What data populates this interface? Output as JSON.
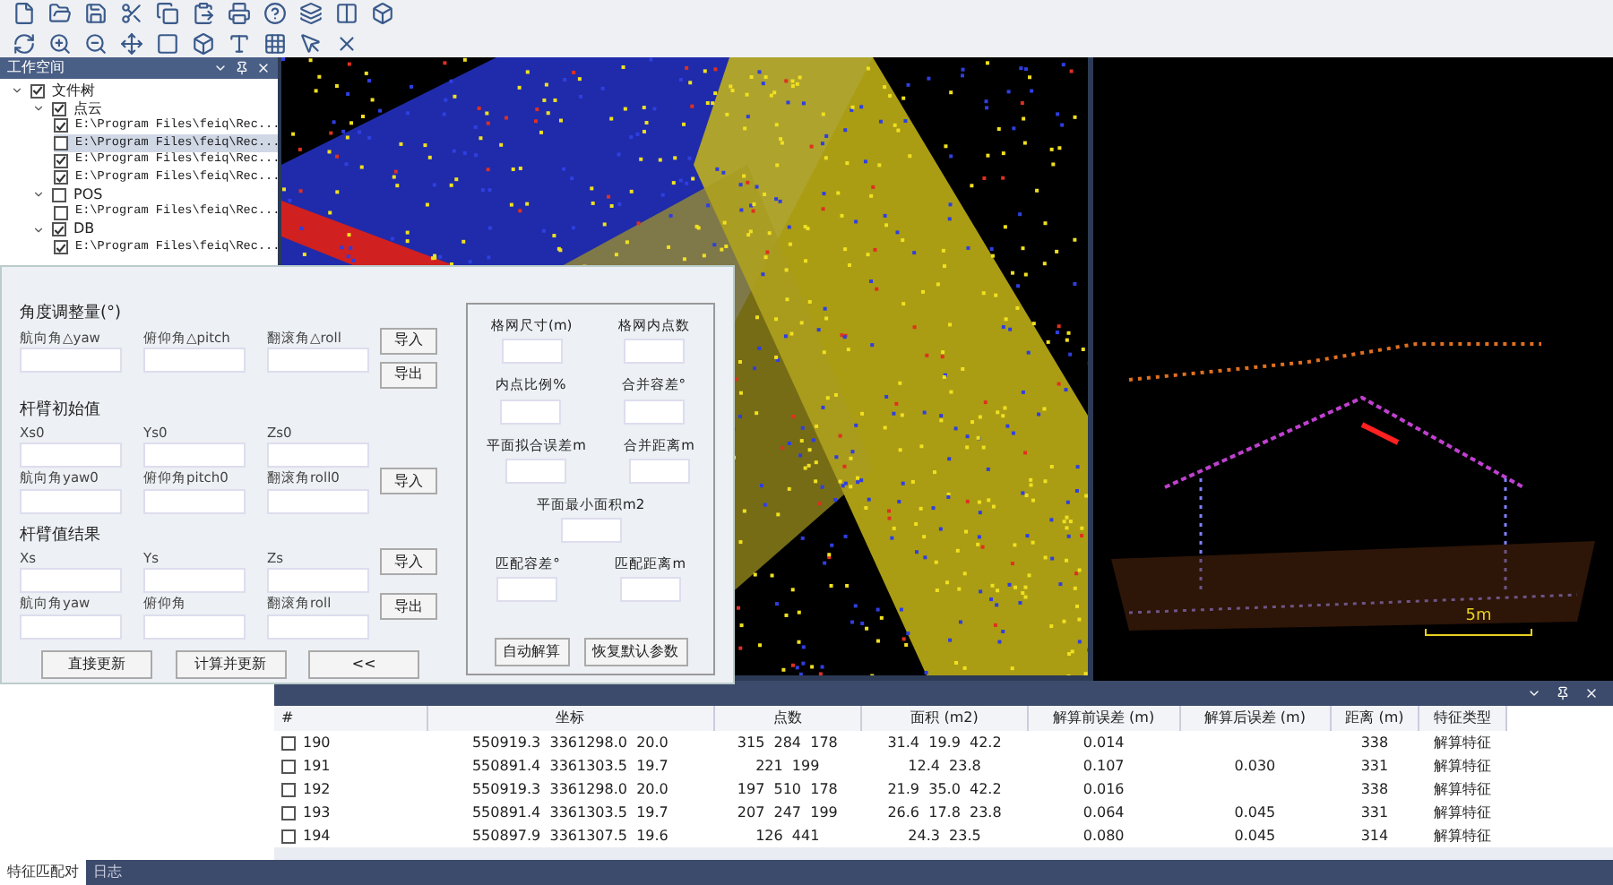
{
  "workspace": {
    "title": "工作空间",
    "tree": [
      {
        "label": "文件树",
        "checked": true,
        "expanded": true,
        "children": [
          {
            "label": "点云",
            "checked": true,
            "expanded": true,
            "children": [
              {
                "label": "E:\\Program Files\\feiq\\Rec...",
                "checked": true,
                "selected": false
              },
              {
                "label": "E:\\Program Files\\feiq\\Rec...",
                "checked": false,
                "selected": true
              },
              {
                "label": "E:\\Program Files\\feiq\\Rec...",
                "checked": true,
                "selected": false
              },
              {
                "label": "E:\\Program Files\\feiq\\Rec...",
                "checked": true,
                "selected": false
              }
            ]
          },
          {
            "label": "POS",
            "checked": false,
            "expanded": true,
            "children": [
              {
                "label": "E:\\Program Files\\feiq\\Rec...",
                "checked": false,
                "selected": false
              }
            ]
          },
          {
            "label": "DB",
            "checked": true,
            "expanded": true,
            "children": [
              {
                "label": "E:\\Program Files\\feiq\\Rec...",
                "checked": true,
                "selected": false
              }
            ]
          }
        ]
      }
    ]
  },
  "dialog": {
    "sections": [
      {
        "title": "角度调整量(°)",
        "rows": [
          {
            "labels": [
              "航向角△yaw",
              "俯仰角△pitch",
              "翻滚角△roll"
            ],
            "buttons": [
              "导入",
              "导出"
            ]
          }
        ]
      },
      {
        "title": "杆臂初始值",
        "rows": [
          {
            "labels": [
              "Xs0",
              "Ys0",
              "Zs0"
            ],
            "buttons": []
          },
          {
            "labels": [
              "航向角yaw0",
              "俯仰角pitch0",
              "翻滚角roll0"
            ],
            "buttons": [
              "导入"
            ]
          }
        ]
      },
      {
        "title": "杆臂值结果",
        "rows": [
          {
            "labels": [
              "Xs",
              "Ys",
              "Zs"
            ],
            "buttons": [
              "导入"
            ]
          },
          {
            "labels": [
              "航向角yaw",
              "俯仰角",
              "翻滚角roll"
            ],
            "buttons": [
              "导出"
            ]
          }
        ]
      }
    ],
    "actions": [
      "直接更新",
      "计算并更新",
      "<<"
    ],
    "params": [
      [
        "格网尺寸(m)",
        "格网内点数"
      ],
      [
        "内点比例%",
        "合并容差°"
      ],
      [
        "平面拟合误差m",
        "合并距离m"
      ],
      [
        "平面最小面积m2"
      ],
      [
        "匹配容差°",
        "匹配距离m"
      ]
    ],
    "param_actions": [
      "自动解算",
      "恢复默认参数"
    ]
  },
  "side_view": {
    "scale_label": "5m"
  },
  "table": {
    "columns": [
      "#",
      "坐标",
      "点数",
      "面积 (m2)",
      "解算前误差 (m)",
      "解算后误差 (m)",
      "距离 (m)",
      "特征类型"
    ],
    "rows": [
      {
        "checked": false,
        "cells": [
          "190",
          "550919.3  3361298.0  20.0",
          "315  284  178",
          "31.4  19.9  42.2",
          "0.014",
          "",
          "338",
          "解算特征"
        ]
      },
      {
        "checked": false,
        "cells": [
          "191",
          "550891.4  3361303.5  19.7",
          "221  199",
          "12.4  23.8",
          "0.107",
          "0.030",
          "331",
          "解算特征"
        ]
      },
      {
        "checked": false,
        "cells": [
          "192",
          "550919.3  3361298.0  20.0",
          "197  510  178",
          "21.9  35.0  42.2",
          "0.016",
          "",
          "338",
          "解算特征"
        ]
      },
      {
        "checked": false,
        "cells": [
          "193",
          "550891.4  3361303.5  19.7",
          "207  247  199",
          "26.6  17.8  23.8",
          "0.064",
          "0.045",
          "331",
          "解算特征"
        ]
      },
      {
        "checked": false,
        "cells": [
          "194",
          "550897.9  3361307.5  19.6",
          "126  441",
          "24.3  23.5",
          "0.080",
          "0.045",
          "314",
          "解算特征"
        ]
      }
    ]
  },
  "bottom_tabs": [
    {
      "label": "特征匹配对",
      "selected": true
    },
    {
      "label": "日志",
      "selected": false
    }
  ]
}
